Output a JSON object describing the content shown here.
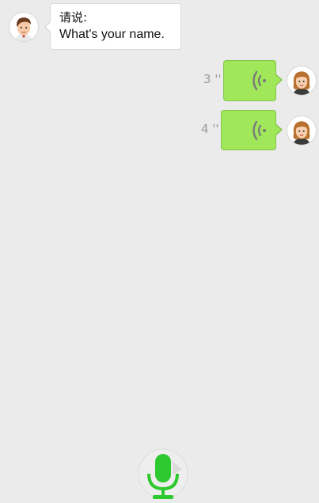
{
  "conversation": {
    "prompt": {
      "label": "请说:",
      "text": "What's your name.",
      "avatar_icon": "male-avatar-icon"
    },
    "voice_messages": [
      {
        "duration": "3 ''",
        "icon": "sound-wave-icon",
        "avatar_icon": "female-avatar-icon"
      },
      {
        "duration": "4 ''",
        "icon": "sound-wave-icon",
        "avatar_icon": "female-avatar-icon"
      }
    ]
  },
  "footer": {
    "record_icon": "microphone-icon"
  },
  "colors": {
    "background": "#ebebeb",
    "voice_bubble": "#a0e75a",
    "microphone": "#2ec92e"
  }
}
